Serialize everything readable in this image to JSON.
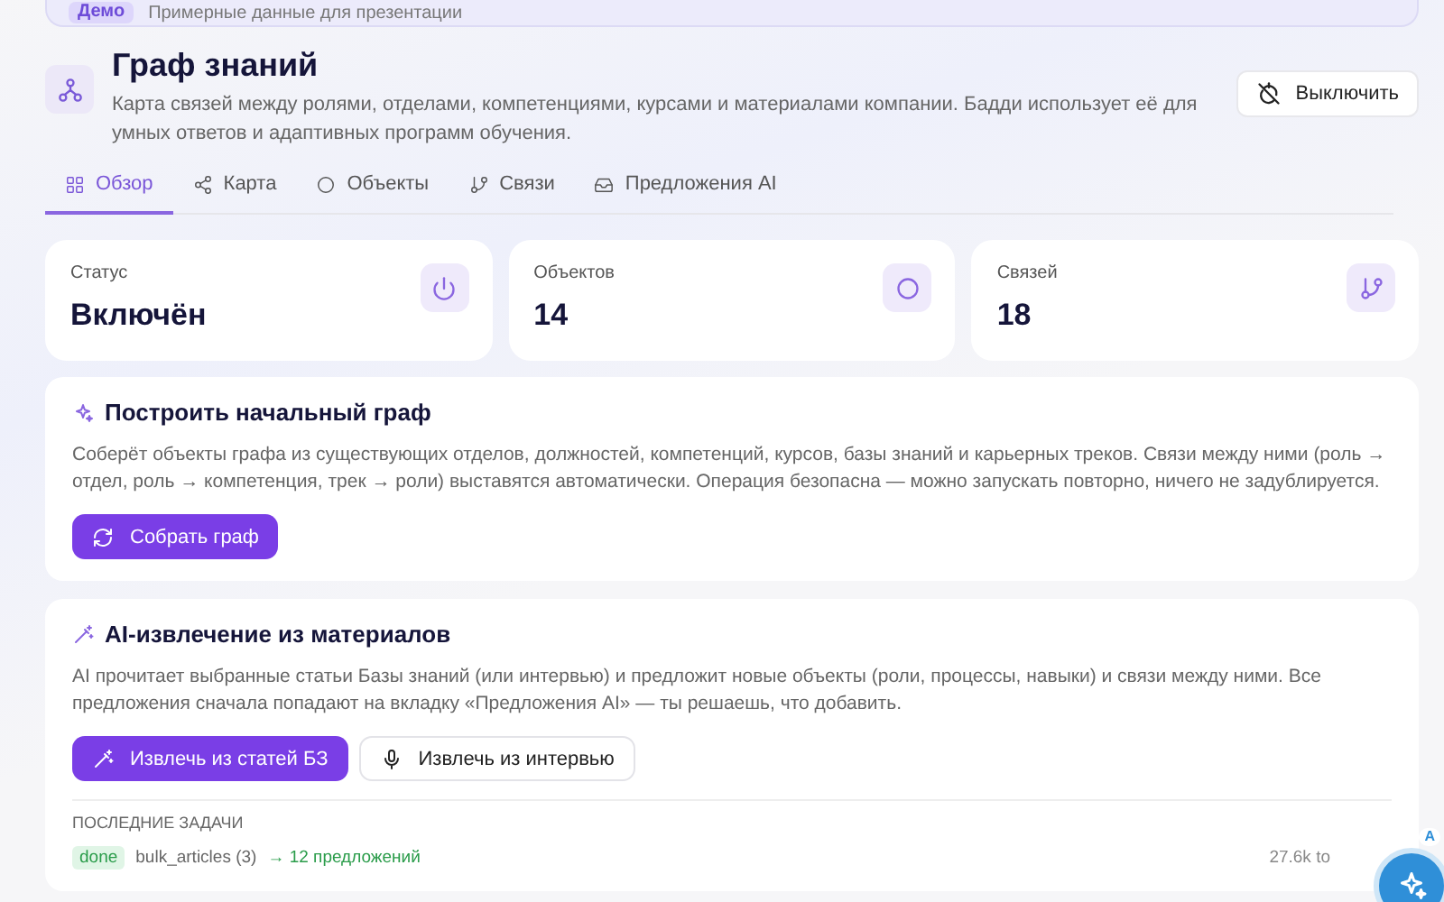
{
  "demo_banner": {
    "badge": "Демо",
    "text": "Примерные данные для презентации"
  },
  "header": {
    "title": "Граф знаний",
    "description": "Карта связей между ролями, отделами, компетенциями, курсами и материалами компании. Бадди использует её для умных ответов и адаптивных программ обучения.",
    "disable_button": "Выключить"
  },
  "tabs": [
    {
      "label": "Обзор",
      "selected": true
    },
    {
      "label": "Карта",
      "selected": false
    },
    {
      "label": "Объекты",
      "selected": false
    },
    {
      "label": "Связи",
      "selected": false
    },
    {
      "label": "Предложения AI",
      "selected": false
    }
  ],
  "stats": [
    {
      "label": "Статус",
      "value": "Включён"
    },
    {
      "label": "Объектов",
      "value": "14"
    },
    {
      "label": "Связей",
      "value": "18"
    }
  ],
  "build_card": {
    "title": "Построить начальный граф",
    "description": "Соберёт объекты графа из существующих отделов, должностей, компетенций, курсов, базы знаний и карьерных треков. Связи между ними (роль → отдел, роль → компетенция, трек → роли) выставятся автоматически. Операция безопасна — можно запускать повторно, ничего не задублируется.",
    "button": "Собрать граф"
  },
  "extract_card": {
    "title": "AI-извлечение из материалов",
    "description": "AI прочитает выбранные статьи Базы знаний (или интервью) и предложит новые объекты (роли, процессы, навыки) и связи между ними. Все предложения сначала попадают на вкладку «Предложения AI» — ты решаешь, что добавить.",
    "buttons": [
      {
        "label": "Извлечь из статей БЗ",
        "kind": "primary"
      },
      {
        "label": "Извлечь из интервью",
        "kind": "secondary"
      }
    ],
    "tasks_heading": "ПОСЛЕДНИЕ ЗАДАЧИ",
    "tasks": [
      {
        "status": "done",
        "source": "bulk_articles (3)",
        "result": "→ 12 предложений",
        "tokens": "27.6k to"
      }
    ]
  },
  "assistant_fab": {
    "badge": "A"
  }
}
